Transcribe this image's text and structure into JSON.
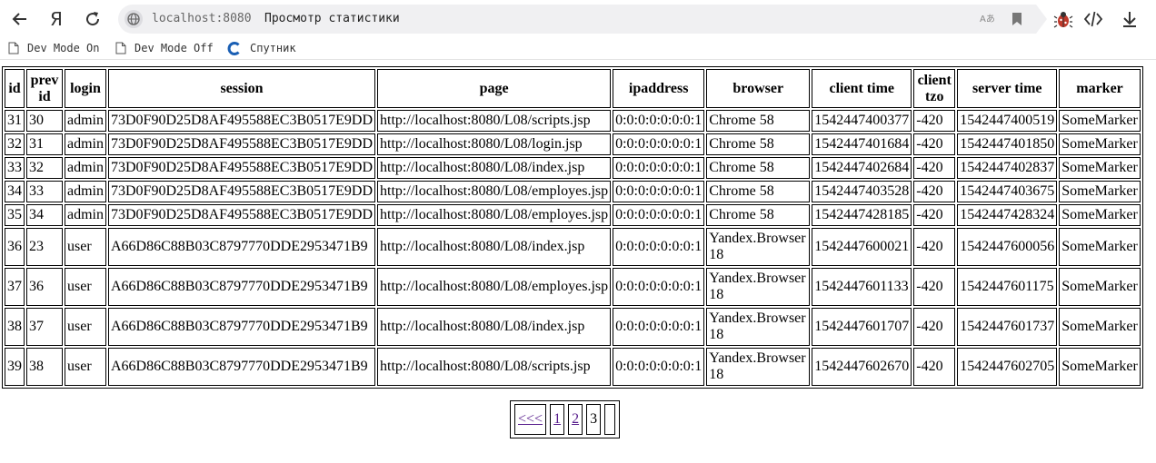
{
  "browser": {
    "address_host": "localhost:8080",
    "page_title": "Просмотр статистики",
    "translate_glyph": "Aあ",
    "bookmarks": [
      "Dev Mode On",
      "Dev Mode Off",
      "Спутник"
    ]
  },
  "table": {
    "headers": {
      "id": "id",
      "prev_id": "prev id",
      "login": "login",
      "session": "session",
      "page": "page",
      "ipaddress": "ipaddress",
      "browser": "browser",
      "client_time": "client time",
      "client_tzo": "client tzo",
      "server_time": "server time",
      "marker": "marker"
    },
    "rows": [
      {
        "id": "31",
        "prev_id": "30",
        "login": "admin",
        "session": "73D0F90D25D8AF495588EC3B0517E9DD",
        "page": "http://localhost:8080/L08/scripts.jsp",
        "ipaddress": "0:0:0:0:0:0:0:1",
        "browser": "Chrome 58",
        "client_time": "1542447400377",
        "client_tzo": "-420",
        "server_time": "1542447400519",
        "marker": "SomeMarker"
      },
      {
        "id": "32",
        "prev_id": "31",
        "login": "admin",
        "session": "73D0F90D25D8AF495588EC3B0517E9DD",
        "page": "http://localhost:8080/L08/login.jsp",
        "ipaddress": "0:0:0:0:0:0:0:1",
        "browser": "Chrome 58",
        "client_time": "1542447401684",
        "client_tzo": "-420",
        "server_time": "1542447401850",
        "marker": "SomeMarker"
      },
      {
        "id": "33",
        "prev_id": "32",
        "login": "admin",
        "session": "73D0F90D25D8AF495588EC3B0517E9DD",
        "page": "http://localhost:8080/L08/index.jsp",
        "ipaddress": "0:0:0:0:0:0:0:1",
        "browser": "Chrome 58",
        "client_time": "1542447402684",
        "client_tzo": "-420",
        "server_time": "1542447402837",
        "marker": "SomeMarker"
      },
      {
        "id": "34",
        "prev_id": "33",
        "login": "admin",
        "session": "73D0F90D25D8AF495588EC3B0517E9DD",
        "page": "http://localhost:8080/L08/employes.jsp",
        "ipaddress": "0:0:0:0:0:0:0:1",
        "browser": "Chrome 58",
        "client_time": "1542447403528",
        "client_tzo": "-420",
        "server_time": "1542447403675",
        "marker": "SomeMarker"
      },
      {
        "id": "35",
        "prev_id": "34",
        "login": "admin",
        "session": "73D0F90D25D8AF495588EC3B0517E9DD",
        "page": "http://localhost:8080/L08/employes.jsp",
        "ipaddress": "0:0:0:0:0:0:0:1",
        "browser": "Chrome 58",
        "client_time": "1542447428185",
        "client_tzo": "-420",
        "server_time": "1542447428324",
        "marker": "SomeMarker"
      },
      {
        "id": "36",
        "prev_id": "23",
        "login": "user",
        "session": "A66D86C88B03C8797770DDE2953471B9",
        "page": "http://localhost:8080/L08/index.jsp",
        "ipaddress": "0:0:0:0:0:0:0:1",
        "browser": "Yandex.Browser 18",
        "client_time": "1542447600021",
        "client_tzo": "-420",
        "server_time": "1542447600056",
        "marker": "SomeMarker"
      },
      {
        "id": "37",
        "prev_id": "36",
        "login": "user",
        "session": "A66D86C88B03C8797770DDE2953471B9",
        "page": "http://localhost:8080/L08/employes.jsp",
        "ipaddress": "0:0:0:0:0:0:0:1",
        "browser": "Yandex.Browser 18",
        "client_time": "1542447601133",
        "client_tzo": "-420",
        "server_time": "1542447601175",
        "marker": "SomeMarker"
      },
      {
        "id": "38",
        "prev_id": "37",
        "login": "user",
        "session": "A66D86C88B03C8797770DDE2953471B9",
        "page": "http://localhost:8080/L08/index.jsp",
        "ipaddress": "0:0:0:0:0:0:0:1",
        "browser": "Yandex.Browser 18",
        "client_time": "1542447601707",
        "client_tzo": "-420",
        "server_time": "1542447601737",
        "marker": "SomeMarker"
      },
      {
        "id": "39",
        "prev_id": "38",
        "login": "user",
        "session": "A66D86C88B03C8797770DDE2953471B9",
        "page": "http://localhost:8080/L08/scripts.jsp",
        "ipaddress": "0:0:0:0:0:0:0:1",
        "browser": "Yandex.Browser 18",
        "client_time": "1542447602670",
        "client_tzo": "-420",
        "server_time": "1542447602705",
        "marker": "SomeMarker"
      }
    ]
  },
  "pager": {
    "prev": "<<<",
    "pages": [
      "1",
      "2"
    ],
    "current": "3",
    "next": ""
  },
  "colors": {
    "link": "#551a8b",
    "address_bar_bg": "#f0f0f2",
    "bug_icon": "#c0392b"
  },
  "icons": [
    "back-icon",
    "yandex-logo-icon",
    "reload-icon",
    "site-info-icon",
    "translate-icon",
    "bookmark-icon",
    "bug-extension-icon",
    "devtools-icon",
    "download-icon",
    "page-icon",
    "sputnik-icon"
  ]
}
